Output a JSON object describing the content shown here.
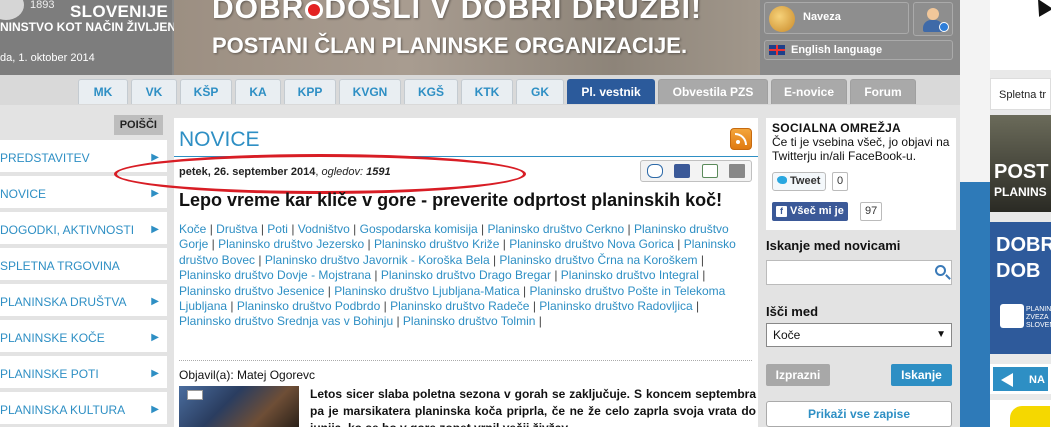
{
  "header": {
    "logo_year": "1893",
    "logo_title": "SLOVENIJE",
    "logo_subtitle": "NINSTVO KOT NAČIN ŽIVLJENJA",
    "date": "da, 1. oktober 2014",
    "banner_line1_a": "DOBR",
    "banner_line1_b": "DOŠLI V DOBRI DRUŽBI!",
    "banner_line2": "POSTANI ČLAN PLANINSKE ORGANIZACIJE.",
    "login_label": "Naveza",
    "language_label": "English language"
  },
  "nav": {
    "tabs": [
      {
        "label": "MK",
        "w": 50
      },
      {
        "label": "VK",
        "w": 46
      },
      {
        "label": "KŠP",
        "w": 52
      },
      {
        "label": "KA",
        "w": 46
      },
      {
        "label": "KPP",
        "w": 52
      },
      {
        "label": "KVGN",
        "w": 62
      },
      {
        "label": "KGŠ",
        "w": 54
      },
      {
        "label": "KTK",
        "w": 52
      },
      {
        "label": "GK",
        "w": 48
      }
    ],
    "active_tab": "Pl. vestnik",
    "gray_tabs": [
      "Obvestila PZS",
      "E-novice",
      "Forum"
    ]
  },
  "sidebar": {
    "search_button": "POIŠČI",
    "items": [
      {
        "label": "PREDSTAVITEV",
        "chevron": true
      },
      {
        "label": "NOVICE",
        "chevron": true
      },
      {
        "label": "DOGODKI, AKTIVNOSTI",
        "chevron": true
      },
      {
        "label": "SPLETNA TRGOVINA",
        "chevron": false
      },
      {
        "label": "PLANINSKA DRUŠTVA",
        "chevron": true
      },
      {
        "label": "PLANINSKE KOČE",
        "chevron": true
      },
      {
        "label": "PLANINSKE POTI",
        "chevron": true
      },
      {
        "label": "PLANINSKA KULTURA",
        "chevron": true
      }
    ]
  },
  "main": {
    "section_title": "NOVICE",
    "date": "petek, 26. september 2014",
    "views_label": "ogledov:",
    "views": "1591",
    "article_title": "Lepo vreme kar kliče v gore - preverite odprtost planinskih koč!",
    "tags": [
      "Koče",
      "Društva",
      "Poti",
      "Vodništvo",
      "Gospodarska komisija",
      "Planinsko društvo Cerkno",
      "Planinsko društvo Gorje",
      "Planinsko društvo Jezersko",
      "Planinsko društvo Križe",
      "Planinsko društvo Nova Gorica",
      "Planinsko društvo Bovec",
      "Planinsko društvo Javornik - Koroška Bela",
      "Planinsko društvo Črna na Koroškem",
      "Planinsko društvo Dovje - Mojstrana",
      "Planinsko društvo Drago Bregar",
      "Planinsko društvo Integral",
      "Planinsko društvo Jesenice",
      "Planinsko društvo Ljubljana-Matica",
      "Planinsko društvo Pošte in Telekoma Ljubljana",
      "Planinsko društvo Podbrdo",
      "Planinsko društvo Radeče",
      "Planinsko društvo Radovljica",
      "Planinsko društvo Srednja vas v Bohinju",
      "Planinsko društvo Tolmin"
    ],
    "author": "Objavil(a): Matej Ogorevc",
    "lead": "Letos sicer slaba poletna sezona v gorah se zaključuje. S koncem septembra pa je marsikatera planinska koča priprla, če ne že celo zaprla svoja vrata do junija, ko se bo v gore zopet vrnil večji živžav."
  },
  "right": {
    "social_title": "SOCIALNA OMREŽJA",
    "social_text": "Če ti je vsebina všeč, jo objavi na Twitterju in/ali FaceBook-u.",
    "tweet_label": "Tweet",
    "tweet_count": "0",
    "fb_label": "Všeč mi je",
    "fb_count": "97",
    "search_label": "Iskanje med novicami",
    "search_placeholder": "",
    "search_in_label": "Išči med",
    "search_in_value": "Koče",
    "clear_label": "Izprazni",
    "search_button": "Iskanje",
    "show_all": "Prikaži vse zapise"
  },
  "far_right": {
    "tip": "Spletna tr",
    "ad2_line1": "POST",
    "ad2_line2": "PLANINS",
    "ad3_line1": "DOBR",
    "ad3_line2": "DOB",
    "ad3_caption": "PLANIN ZVEZA SLOVEN",
    "nav_label": "NA"
  }
}
